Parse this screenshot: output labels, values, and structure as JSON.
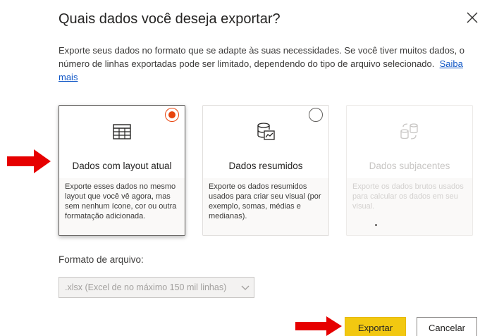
{
  "dialog": {
    "title": "Quais dados você deseja exportar?",
    "description": "Exporte seus dados no formato que se adapte às suas necessidades. Se você tiver muitos dados, o número de linhas exportadas pode ser limitado, dependendo do tipo de arquivo selecionado.",
    "learn_more": "Saiba mais",
    "close_icon": "close-icon"
  },
  "options": [
    {
      "title": "Dados com layout atual",
      "description": "Exporte esses dados no mesmo layout que você vê agora, mas sem nenhum ícone, cor ou outra formatação adicionada.",
      "icon": "table-icon",
      "selected": true,
      "disabled": false
    },
    {
      "title": "Dados resumidos",
      "description": "Exporte os dados resumidos usados para criar seu visual (por exemplo, somas, médias e medianas).",
      "icon": "summarized-data-icon",
      "selected": false,
      "disabled": false
    },
    {
      "title": "Dados subjacentes",
      "description": "Exporte os dados brutos usados para calcular os dados em seu visual.",
      "icon": "underlying-data-icon",
      "selected": false,
      "disabled": true
    }
  ],
  "format": {
    "label": "Formato de arquivo:",
    "selected": ".xlsx (Excel de no máximo 150 mil linhas)"
  },
  "buttons": {
    "export": "Exportar",
    "cancel": "Cancelar"
  },
  "colors": {
    "accent_radio": "#e8440d",
    "primary_button": "#f2c811",
    "annotation_arrow": "#e60000",
    "link": "#0f56c6"
  }
}
